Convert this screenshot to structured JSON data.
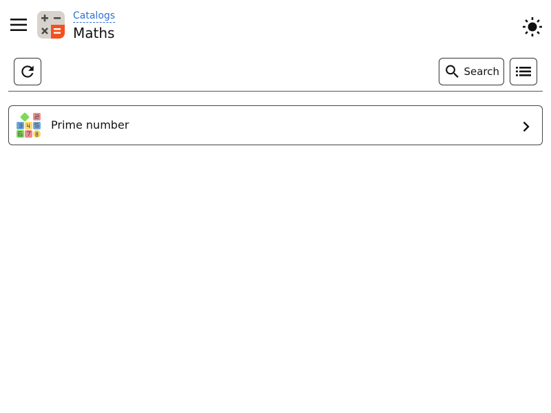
{
  "header": {
    "breadcrumb": "Catalogs",
    "title": "Maths",
    "menu_icon": "hamburger-menu-icon",
    "logo_icon": "calculator-icon",
    "theme_icon": "sun-icon"
  },
  "toolbar": {
    "refresh_icon": "refresh-icon",
    "search_label": "Search",
    "search_icon": "magnifier-icon",
    "list_view_icon": "list-view-icon"
  },
  "catalog_items": [
    {
      "label": "Prime number",
      "icon": "number-blocks-icon",
      "chevron": "chevron-right-icon"
    }
  ],
  "colors": {
    "link": "#2f6fd6",
    "logo_orange": "#f4511e",
    "logo_gray": "#d8d2cc",
    "border": "#444444"
  }
}
